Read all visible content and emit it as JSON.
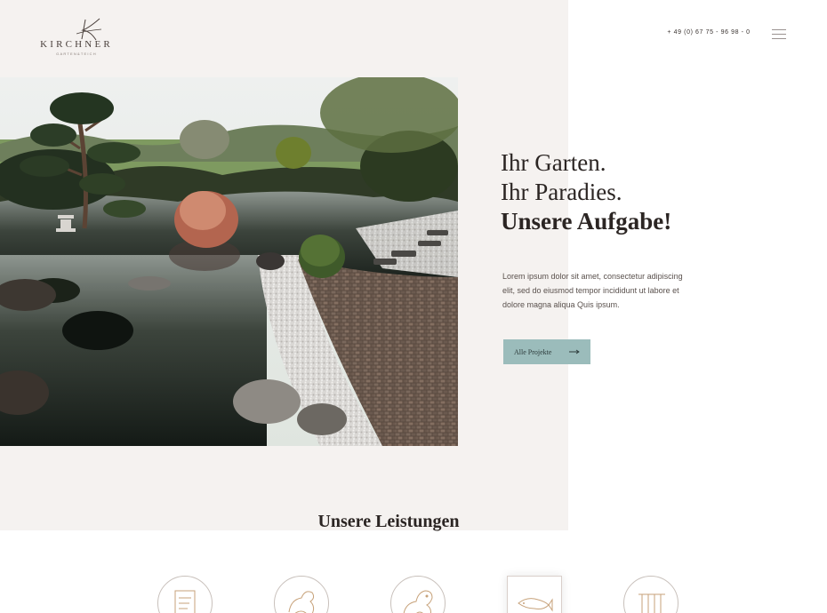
{
  "brand": {
    "name": "KIRCHNER",
    "tagline": "GARTEN&TEICH"
  },
  "header": {
    "phone": "+ 49 (0) 67 75 - 96 98 - 0",
    "menu_icon": "hamburger-menu-icon"
  },
  "hero": {
    "image_alt": "Japanese garden with koi pond, stone path and bonsai trees",
    "headline": [
      "Ihr Garten.",
      "Ihr Paradies.",
      "Unsere Aufgabe!"
    ],
    "lead": "Lorem ipsum dolor sit amet, consectetur adipiscing elit, sed do eiusmod tempor incididunt ut labore et dolore magna aliqua Quis ipsum.",
    "cta_label": "Alle Projekte",
    "cta_icon": "arrow-right-icon"
  },
  "services": {
    "title": "Unsere Leistungen",
    "items": [
      {
        "icon": "document-icon"
      },
      {
        "icon": "turtle-icon"
      },
      {
        "icon": "frog-icon"
      },
      {
        "icon": "fish-icon",
        "active": true
      },
      {
        "icon": "waterfall-icon"
      }
    ]
  },
  "colors": {
    "panel": "#f5f2f0",
    "accent": "#9bbcbb",
    "icon_stroke": "#c7a27a",
    "text": "#2b2523"
  }
}
